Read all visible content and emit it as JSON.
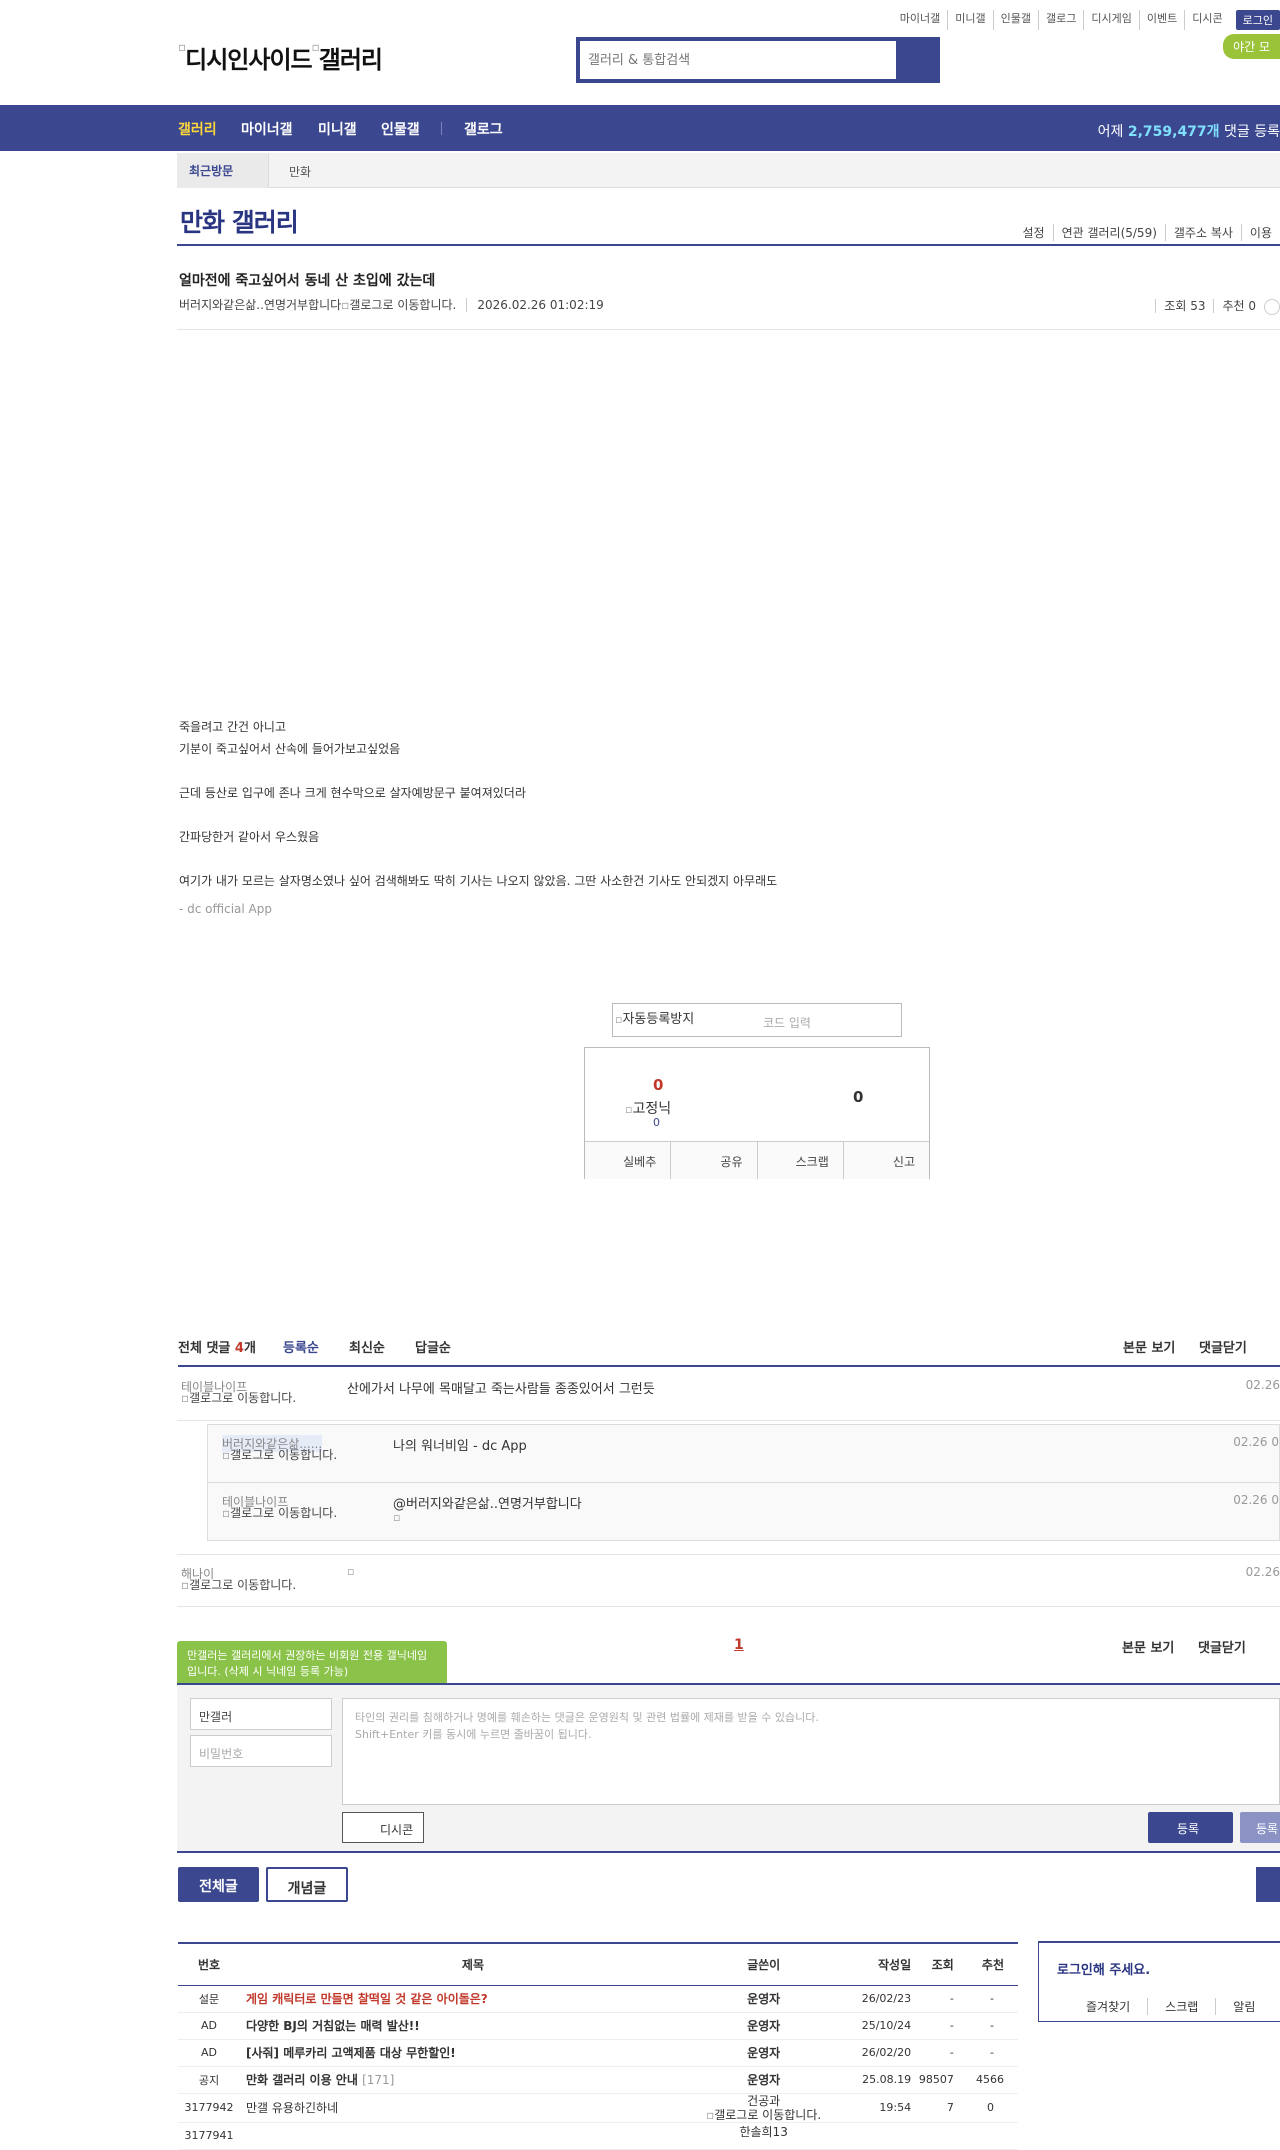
{
  "header": {
    "top_links": [
      "마이너갤",
      "미니갤",
      "인물갤",
      "갤로그",
      "디시게임",
      "이벤트",
      "디시콘"
    ],
    "login": "로그인",
    "night_mode": "야간 모",
    "logo_alt": "디시인사이드",
    "logo_gallery_alt": "갤러리",
    "search_placeholder": "갤러리 & 통합검색"
  },
  "nav": {
    "items": [
      "갤러리",
      "마이너갤",
      "미니갤",
      "인물갤",
      "갤로그"
    ],
    "stat_prefix": "어제",
    "stat_count": "2,759,477개",
    "stat_suffix": "댓글 등록"
  },
  "recent": {
    "label": "최근방문",
    "item": "만화"
  },
  "gallery": {
    "title": "만화 갤러리",
    "tools": [
      "설정",
      "연관 갤러리(5/59)",
      "갤주소 복사",
      "이용"
    ]
  },
  "post": {
    "title": "얼마전에 죽고싶어서 동네 산 초입에 갔는데",
    "author": "버러지와같은삶..연명거부합니다",
    "author_icon_alt": "갤로그로 이동합니다.",
    "date": "2026.02.26 01:02:19",
    "views": "조회 53",
    "recommend": "추천 0",
    "body": [
      "죽을려고 간건 아니고",
      "기분이 죽고싶어서 산속에 들어가보고싶었음",
      "",
      "근데 등산로 입구에 존나 크게 현수막으로 살자예방문구 붙여져있더라",
      "",
      "간파당한거 같아서 우스웠음",
      "",
      "여기가 내가 모르는 살자명소였나 싶어 검색해봐도 딱히 기사는 나오지 않았음. 그딴 사소한건 기사도 안되겠지 아무래도"
    ],
    "app_sig": "- dc official App"
  },
  "captcha": {
    "img_alt": "자동등록방지",
    "placeholder": "코드 입력"
  },
  "vote": {
    "up": "0",
    "fixed_alt": "고정닉",
    "fixed_count": "0",
    "down": "0",
    "buttons": [
      "실베추",
      "공유",
      "스크랩",
      "신고"
    ]
  },
  "comments_header": {
    "all_label": "전체 댓글",
    "count": "4",
    "count_unit": "개",
    "sort": [
      "등록순",
      "최신순",
      "답글순"
    ],
    "right": [
      "본문 보기",
      "댓글닫기"
    ]
  },
  "comments": [
    {
      "nick": "테이블나이프",
      "icon_alt": "갤로그로 이동합니다.",
      "text": "산에가서 나무에 목매달고 죽는사람들 종종있어서 그런듯",
      "date": "02.26"
    },
    {
      "nick": "버러지와같은삶......",
      "icon_alt": "갤로그로 이동합니다.",
      "text": "나의 워너비임 - dc App",
      "date": "02.26 0"
    },
    {
      "nick": "테이블나이프",
      "icon_alt": "갤로그로 이동합니다.",
      "mention": "@버러지와같은삶..연명거부합니다",
      "date": "02.26 0"
    },
    {
      "nick": "해나이",
      "icon_alt": "갤로그로 이동합니다.",
      "date": "02.26"
    }
  ],
  "pager": {
    "current": "1",
    "right": [
      "본문 보기",
      "댓글닫기"
    ]
  },
  "comment_form": {
    "tip": "만갤러는 갤러리에서 권장하는 비회원 전용 갤닉네임입니다. (삭제 시 닉네임 등록 가능)",
    "nick_value": "만갤러",
    "pw_placeholder": "비밀번호",
    "textarea_line1": "타인의 권리를 침해하거나 명예를 훼손하는 댓글은 운영원칙 및 관련 법률에 제재를 받을 수 있습니다.",
    "textarea_line2": "Shift+Enter 키를 동시에 누르면 줄바꿈이 됩니다.",
    "dccon": "디시콘",
    "submit": "등록",
    "submit2": "등록"
  },
  "list_tabs": {
    "all": "전체글",
    "concept": "개념글"
  },
  "list": {
    "headers": [
      "번호",
      "제목",
      "글쓴이",
      "작성일",
      "조회",
      "추천"
    ],
    "rows": [
      {
        "no": "설문",
        "title": "게임 캐릭터로 만들면 찰떡일 것 같은 아이돌은?",
        "writer": "운영자",
        "date": "26/02/23",
        "views": "-",
        "rec": "-",
        "red": true
      },
      {
        "no": "AD",
        "title": "다양한 BJ의 거침없는 매력 발산!!",
        "writer": "운영자",
        "date": "25/10/24",
        "views": "-",
        "rec": "-"
      },
      {
        "no": "AD",
        "title": "[사줘] 메루카리 고액제품 대상 무한할인!",
        "writer": "운영자",
        "date": "26/02/20",
        "views": "-",
        "rec": "-"
      },
      {
        "no": "공지",
        "title": "만화 갤러리 이용 안내",
        "comments": "[171]",
        "writer": "운영자",
        "date": "25.08.19",
        "views": "98507",
        "rec": "4566"
      },
      {
        "no": "3177942",
        "title": "만갤 유용하긴하네",
        "writer": "건공과",
        "writer_icon_alt": "갤로그로 이동합니다.",
        "date": "19:54",
        "views": "7",
        "rec": "0",
        "plain": true
      },
      {
        "no": "3177941",
        "title": "",
        "writer": "한솔희13",
        "date": "",
        "views": "",
        "rec": "",
        "plain": true
      }
    ]
  },
  "login_box": {
    "title": "로그인해 주세요.",
    "buttons": [
      "즐겨찾기",
      "스크랩",
      "알림"
    ]
  }
}
